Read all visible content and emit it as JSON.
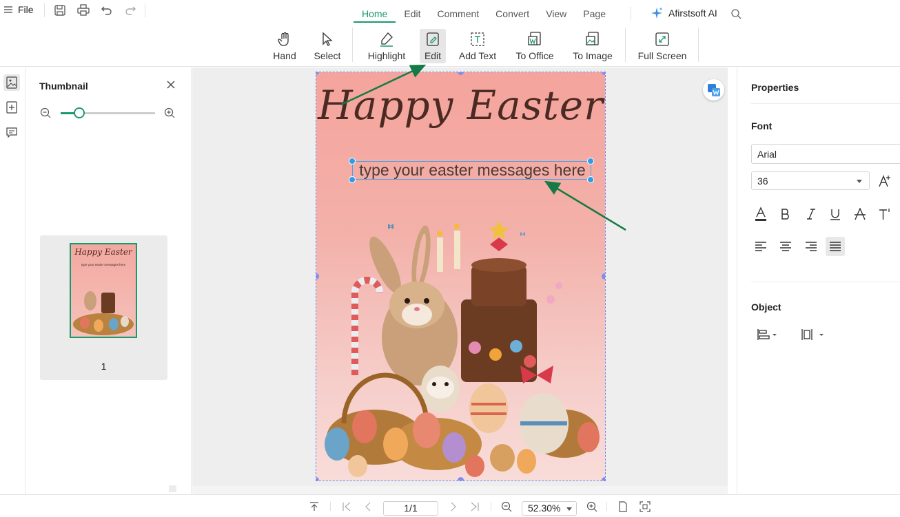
{
  "menu": {
    "file_label": "File"
  },
  "tabs": [
    {
      "label": "Home",
      "active": true
    },
    {
      "label": "Edit"
    },
    {
      "label": "Comment"
    },
    {
      "label": "Convert"
    },
    {
      "label": "View"
    },
    {
      "label": "Page"
    }
  ],
  "ai_label": "Afirstsoft AI",
  "toolbar": {
    "hand": "Hand",
    "select": "Select",
    "highlight": "Highlight",
    "edit": "Edit",
    "add_text": "Add Text",
    "to_office": "To Office",
    "to_image": "To Image",
    "full_screen": "Full Screen"
  },
  "thumbnail_panel": {
    "title": "Thumbnail",
    "zoom_level": 0.2,
    "page_number": "1",
    "thumb_title": "Happy Easter",
    "thumb_subtitle": "type your easter messages here"
  },
  "document": {
    "title": "Happy Easter",
    "selected_text": "type your easter messages here"
  },
  "properties": {
    "title": "Properties",
    "font_section": "Font",
    "font_family": "Arial",
    "font_size": "36",
    "object_section": "Object"
  },
  "statusbar": {
    "page_indicator": "1/1",
    "zoom": "52.30%"
  },
  "colors": {
    "accent": "#1a9a6a",
    "selection": "#2f9be9",
    "page_bg": "#f4a49c"
  }
}
